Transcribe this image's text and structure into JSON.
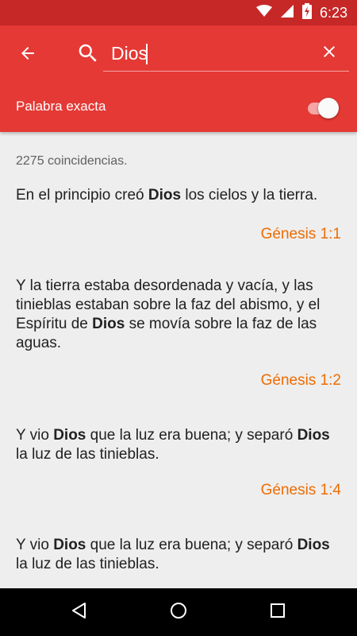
{
  "status_bar": {
    "time": "6:23",
    "icons": [
      "wifi-icon",
      "signal-icon",
      "battery-charging-icon"
    ]
  },
  "toolbar": {
    "back_icon": "arrow-back-icon",
    "search_icon": "search-icon",
    "clear_icon": "close-icon",
    "search_value": "Dios",
    "exact_label": "Palabra exacta",
    "exact_enabled": true
  },
  "results": {
    "count_text": "2275 coincidencias.",
    "items": [
      {
        "segments": [
          "En el principio creó ",
          "Dios",
          " los cielos y la tierra."
        ],
        "reference": "Génesis 1:1"
      },
      {
        "segments": [
          "Y la tierra estaba desordenada y vacía, y las tinieblas estaban sobre la faz del abismo, y el Espíritu de ",
          "Dios",
          " se movía sobre la faz de las aguas."
        ],
        "reference": "Génesis 1:2"
      },
      {
        "segments": [
          "Y vio ",
          "Dios",
          " que la luz era buena; y separó ",
          "Dios",
          " la luz de las tinieblas."
        ],
        "reference": "Génesis 1:4"
      },
      {
        "segments": [
          "Y vio ",
          "Dios",
          " que la luz era buena; y separó ",
          "Dios",
          " la luz de las tinieblas."
        ],
        "reference": ""
      }
    ]
  },
  "colors": {
    "status_bar": "#c62828",
    "toolbar": "#e53935",
    "reference": "#ef6c00"
  },
  "nav_bar": {
    "icons": [
      "nav-back-icon",
      "nav-home-icon",
      "nav-recents-icon"
    ]
  }
}
